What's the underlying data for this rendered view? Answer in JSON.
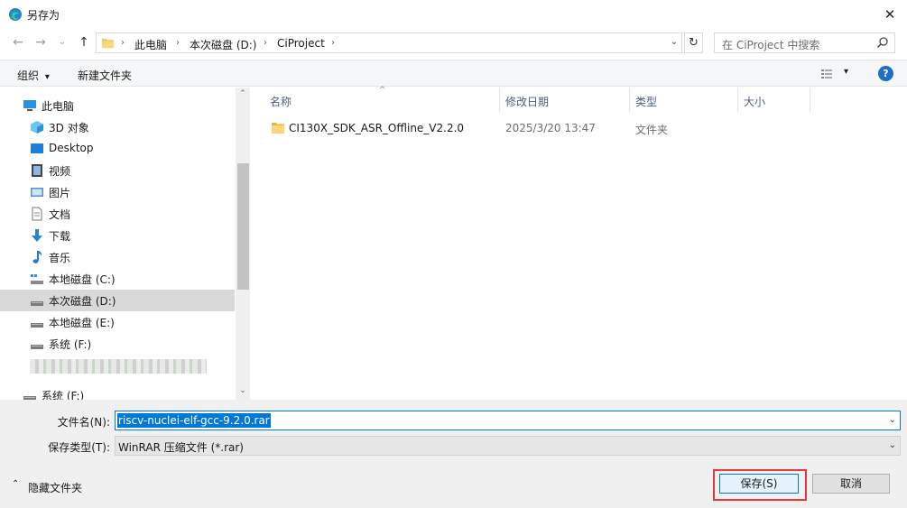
{
  "window": {
    "title": "另存为",
    "close_glyph": "✕"
  },
  "nav": {
    "back_glyph": "←",
    "forward_glyph": "→",
    "recent_glyph": "⌄",
    "up_glyph": "↑",
    "refresh_glyph": "↻",
    "dropdown_glyph": "⌄"
  },
  "breadcrumb": {
    "segments": [
      "此电脑",
      "本次磁盘 (D:)",
      "CiProject"
    ],
    "sep": "›"
  },
  "search": {
    "placeholder": "在 CiProject 中搜索"
  },
  "toolbar": {
    "organize": "组织",
    "organize_arrow": "▾",
    "new_folder": "新建文件夹",
    "view_arrow": "▾",
    "help": "?"
  },
  "sidebar": {
    "items": [
      {
        "label": "此电脑",
        "icon": "pc-icon"
      },
      {
        "label": "3D 对象",
        "icon": "cube-icon"
      },
      {
        "label": "Desktop",
        "icon": "desktop-icon"
      },
      {
        "label": "视频",
        "icon": "video-icon"
      },
      {
        "label": "图片",
        "icon": "picture-icon"
      },
      {
        "label": "文档",
        "icon": "document-icon"
      },
      {
        "label": "下载",
        "icon": "download-icon"
      },
      {
        "label": "音乐",
        "icon": "music-icon"
      },
      {
        "label": "本地磁盘 (C:)",
        "icon": "system-drive-icon"
      },
      {
        "label": "本次磁盘 (D:)",
        "icon": "drive-icon",
        "selected": true
      },
      {
        "label": "本地磁盘 (E:)",
        "icon": "drive-icon"
      },
      {
        "label": "系统 (F:)",
        "icon": "drive-icon"
      },
      {
        "label": "系统 (F:)",
        "icon": "drive-icon"
      }
    ],
    "scroll_up": "⌃",
    "scroll_down": "⌄"
  },
  "filelist": {
    "columns": [
      "名称",
      "修改日期",
      "类型",
      "大小"
    ],
    "sort_indicator": "^",
    "rows": [
      {
        "name": "CI130X_SDK_ASR_Offline_V2.2.0",
        "modified": "2025/3/20 13:47",
        "type": "文件夹",
        "size": ""
      }
    ]
  },
  "form": {
    "filename_label": "文件名(N):",
    "filename_value": "riscv-nuclei-elf-gcc-9.2.0.rar",
    "filetype_label": "保存类型(T):",
    "filetype_value": "WinRAR 压缩文件 (*.rar)"
  },
  "footer": {
    "hide_folders": "隐藏文件夹",
    "hide_folders_arrow": "⌃",
    "save": "保存(S)",
    "cancel": "取消"
  },
  "colors": {
    "accent": "#0078d7",
    "highlight": "#e0393e",
    "folder": "#f2c55c"
  }
}
